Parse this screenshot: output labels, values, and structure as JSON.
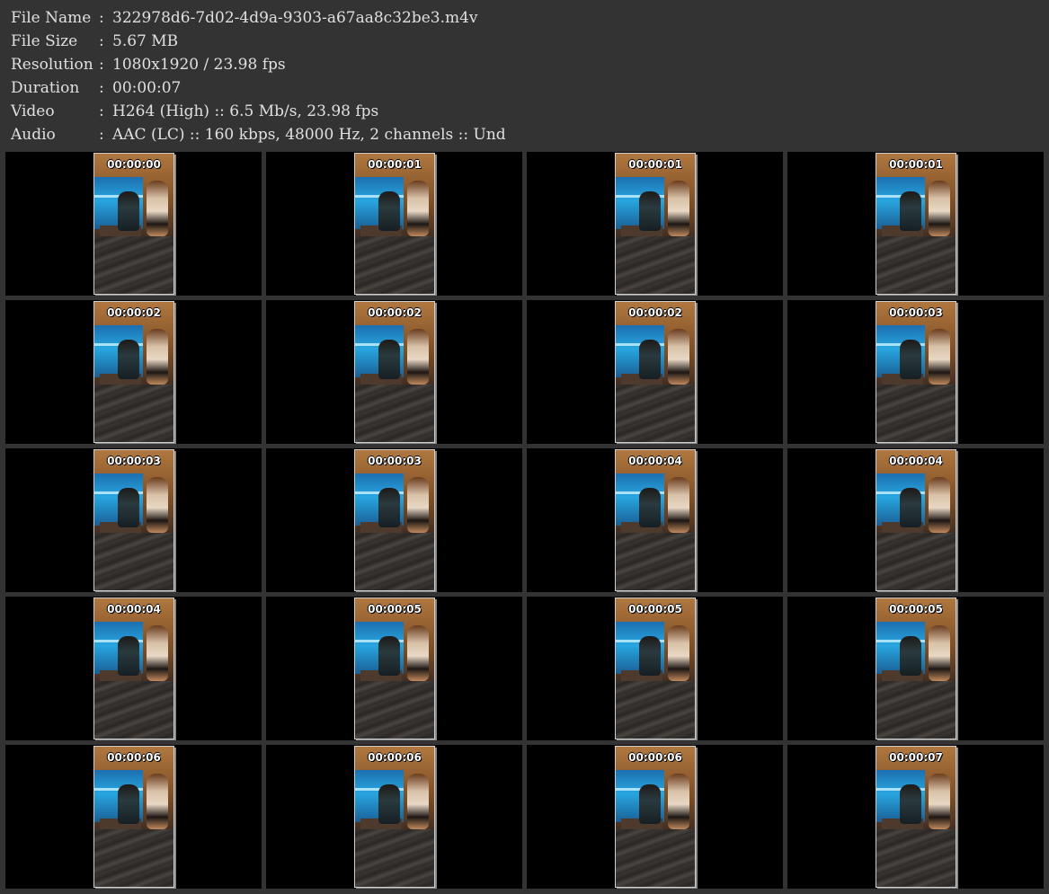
{
  "metadata": [
    {
      "key": "File Name",
      "value": "322978d6-7d02-4d9a-9303-a67aa8c32be3.m4v"
    },
    {
      "key": "File Size",
      "value": "5.67 MB"
    },
    {
      "key": "Resolution",
      "value": "1080x1920 / 23.98 fps"
    },
    {
      "key": "Duration",
      "value": "00:00:07"
    },
    {
      "key": "Video",
      "value": "H264 (High) :: 6.5 Mb/s, 23.98 fps"
    },
    {
      "key": "Audio",
      "value": "AAC (LC) :: 160 kbps, 48000 Hz, 2 channels :: Und"
    }
  ],
  "separator": ":",
  "thumbnails": [
    {
      "timestamp": "00:00:00"
    },
    {
      "timestamp": "00:00:01"
    },
    {
      "timestamp": "00:00:01"
    },
    {
      "timestamp": "00:00:01"
    },
    {
      "timestamp": "00:00:02"
    },
    {
      "timestamp": "00:00:02"
    },
    {
      "timestamp": "00:00:02"
    },
    {
      "timestamp": "00:00:03"
    },
    {
      "timestamp": "00:00:03"
    },
    {
      "timestamp": "00:00:03"
    },
    {
      "timestamp": "00:00:04"
    },
    {
      "timestamp": "00:00:04"
    },
    {
      "timestamp": "00:00:04"
    },
    {
      "timestamp": "00:00:05"
    },
    {
      "timestamp": "00:00:05"
    },
    {
      "timestamp": "00:00:05"
    },
    {
      "timestamp": "00:00:06"
    },
    {
      "timestamp": "00:00:06"
    },
    {
      "timestamp": "00:00:06"
    },
    {
      "timestamp": "00:00:07"
    }
  ],
  "colors": {
    "background": "#333333",
    "cell_background": "#000000",
    "text": "#e0e0e0",
    "timestamp_text": "#ffffff"
  }
}
